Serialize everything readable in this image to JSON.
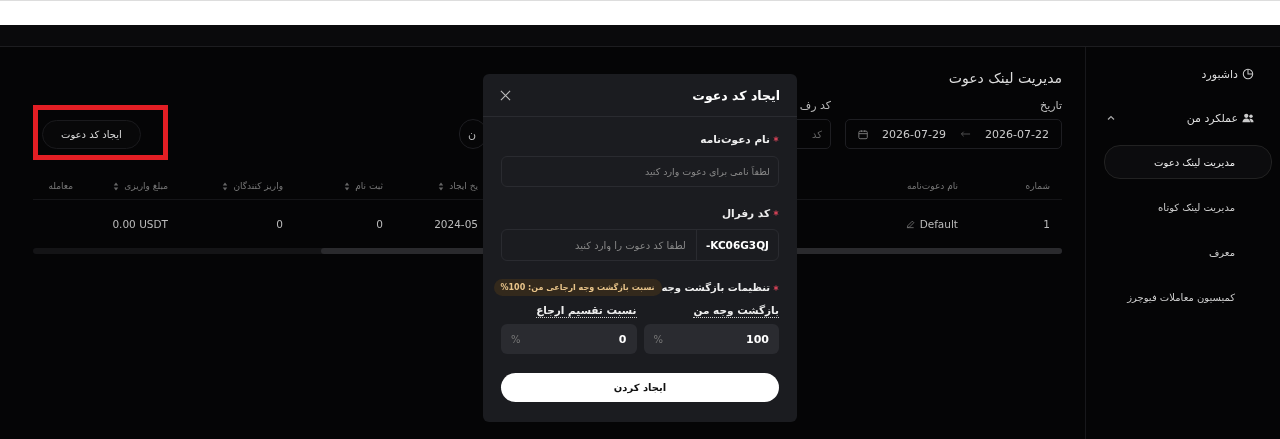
{
  "sidebar": {
    "items": [
      {
        "label": "داشبورد",
        "selected": false
      },
      {
        "label": "عملکرد من",
        "expanded": true,
        "selected": false,
        "children": [
          {
            "label": "مدیریت لینک دعوت",
            "selected": true
          },
          {
            "label": "مدیریت لینک کوتاه",
            "selected": false
          },
          {
            "label": "معرف",
            "selected": false
          },
          {
            "label": "کمیسیون معاملات فیوچرز",
            "selected": false
          }
        ]
      }
    ]
  },
  "page": {
    "title": "مدیریت لینک دعوت",
    "date_filter": {
      "label": "تاریخ",
      "from": "2026-07-22",
      "to": "2026-07-29"
    },
    "referral_filter": {
      "label": "کد رف",
      "placeholder": "کد"
    },
    "partial_button": "ن",
    "create_button": {
      "label": "ایجاد کد دعوت",
      "highlighted": true
    }
  },
  "table": {
    "columns": [
      {
        "label": "شماره",
        "sortable": false
      },
      {
        "label": "نام دعوت‌نامه",
        "sortable": false
      },
      {
        "label": "یخ ایجاد",
        "sortable": true
      },
      {
        "label": "ثبت نام",
        "sortable": true
      },
      {
        "label": "واریز کنندگان",
        "sortable": true
      },
      {
        "label": "مبلغ واریزی",
        "sortable": true
      },
      {
        "label": "معامله",
        "sortable": false
      }
    ],
    "rows": [
      {
        "cells": [
          {
            "text": "1",
            "kind": "text"
          },
          {
            "text": "Default",
            "kind": "editable"
          },
          {
            "text": "2024-05",
            "kind": "text"
          },
          {
            "text": "0",
            "kind": "text"
          },
          {
            "text": "0",
            "kind": "text"
          },
          {
            "text": "0.00 USDT",
            "kind": "text"
          }
        ]
      }
    ]
  },
  "dialog": {
    "title": "ایجاد کد دعوت",
    "name_field": {
      "label": "نام دعوت‌نامه",
      "required": true,
      "placeholder": "لطفاً نامی برای دعوت وارد کنید"
    },
    "code_field": {
      "label": "کد رفرال",
      "required": true,
      "prefix": "-KC06G3QJ",
      "placeholder": "لطفا کد دعوت را وارد کنید"
    },
    "cashback": {
      "label": "تنظیمات بازگشت وجه",
      "required": true,
      "badge": "نسبت بازگشت وجه ارجاعی من: 100%",
      "fields": [
        {
          "label": "بازگشت وجه من",
          "value": "100",
          "unit": "%"
        },
        {
          "label": "نسبت تقسیم ارجاع",
          "value": "0",
          "unit": "%"
        }
      ]
    },
    "submit": "ایجاد کردن"
  }
}
